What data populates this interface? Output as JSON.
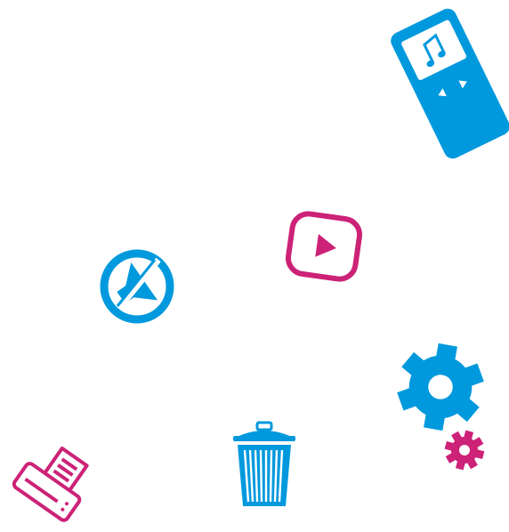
{
  "canvas": {
    "background": "#ffffff"
  },
  "colors": {
    "blue": "#0099dd",
    "magenta": "#cc2277",
    "white": "#ffffff"
  },
  "icons": [
    {
      "name": "media-player-icon",
      "color": "blue"
    },
    {
      "name": "mute-speaker-icon",
      "color": "blue"
    },
    {
      "name": "play-button-icon",
      "color": "magenta"
    },
    {
      "name": "large-gear-icon",
      "color": "blue"
    },
    {
      "name": "small-gear-icon",
      "color": "magenta"
    },
    {
      "name": "trash-can-icon",
      "color": "blue"
    },
    {
      "name": "printer-icon",
      "color": "magenta"
    }
  ]
}
